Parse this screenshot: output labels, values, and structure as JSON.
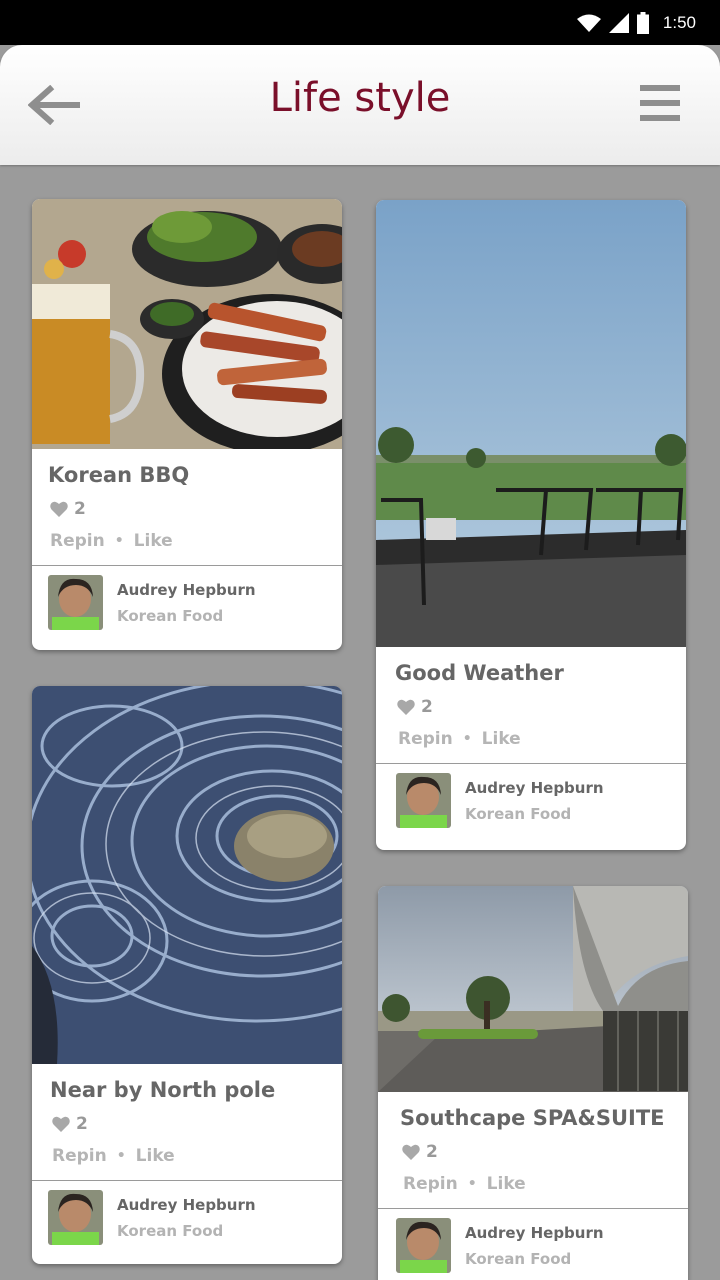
{
  "status_bar": {
    "time": "1:50"
  },
  "app_bar": {
    "title": "Life style"
  },
  "cards": [
    {
      "title": "Korean BBQ",
      "likes": "2",
      "repin": "Repin",
      "like": "Like",
      "author": "Audrey Hepburn",
      "board": "Korean Food"
    },
    {
      "title": "Good Weather",
      "likes": "2",
      "repin": "Repin",
      "like": "Like",
      "author": "Audrey Hepburn",
      "board": "Korean Food"
    },
    {
      "title": "Near by North pole",
      "likes": "2",
      "repin": "Repin",
      "like": "Like",
      "author": "Audrey Hepburn",
      "board": "Korean Food"
    },
    {
      "title": "Southcape SPA&SUITE",
      "likes": "2",
      "repin": "Repin",
      "like": "Like",
      "author": "Audrey Hepburn",
      "board": "Korean Food"
    }
  ],
  "icons": {
    "back": "arrow-left-icon",
    "menu": "hamburger-menu-icon",
    "like": "heart-icon",
    "wifi": "wifi-icon",
    "signal": "cell-signal-icon",
    "battery": "battery-icon"
  },
  "colors": {
    "title": "#7a0f2a",
    "background": "#9b9b9b",
    "card": "#ffffff"
  }
}
